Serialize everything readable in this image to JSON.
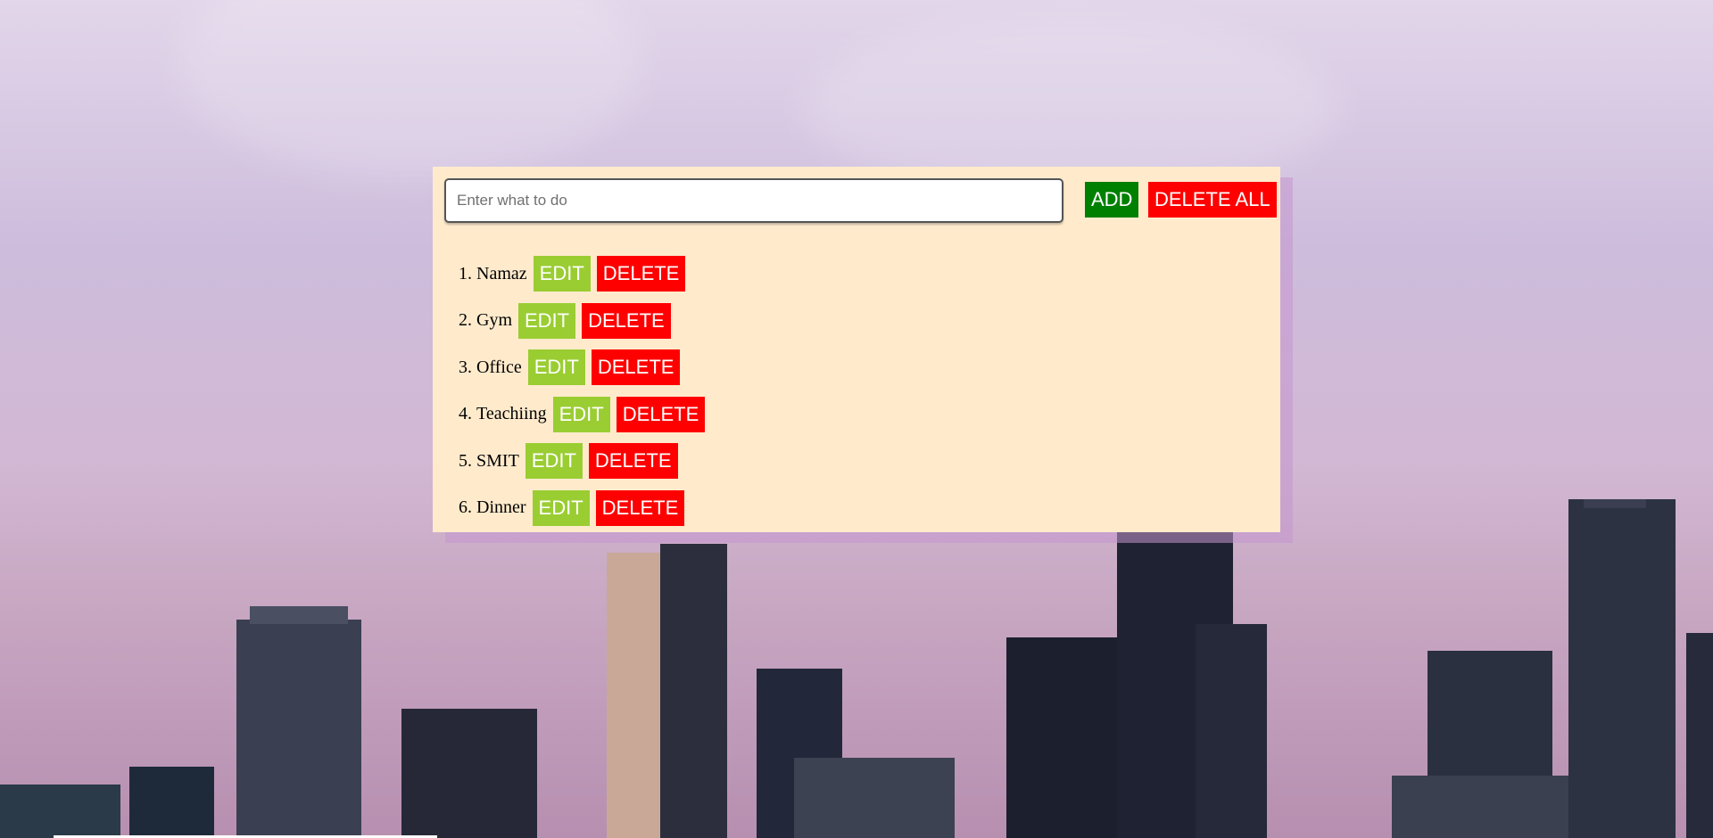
{
  "input": {
    "placeholder": "Enter what to do",
    "value": ""
  },
  "buttons": {
    "add_label": "ADD",
    "delete_all_label": "DELETE ALL"
  },
  "todos": [
    {
      "number": "1.",
      "text": "Namaz",
      "edit_label": "EDIT",
      "delete_label": "DELETE"
    },
    {
      "number": "2.",
      "text": "Gym",
      "edit_label": "EDIT",
      "delete_label": "DELETE"
    },
    {
      "number": "3.",
      "text": "Office",
      "edit_label": "EDIT",
      "delete_label": "DELETE"
    },
    {
      "number": "4.",
      "text": "Teachiing",
      "edit_label": "EDIT",
      "delete_label": "DELETE"
    },
    {
      "number": "5.",
      "text": "SMIT",
      "edit_label": "EDIT",
      "delete_label": "DELETE"
    },
    {
      "number": "6.",
      "text": "Dinner",
      "edit_label": "EDIT",
      "delete_label": "DELETE"
    }
  ],
  "colors": {
    "panel": "#ffebcc",
    "add": "#008000",
    "delete": "#ff0000",
    "edit": "#9acd32"
  }
}
